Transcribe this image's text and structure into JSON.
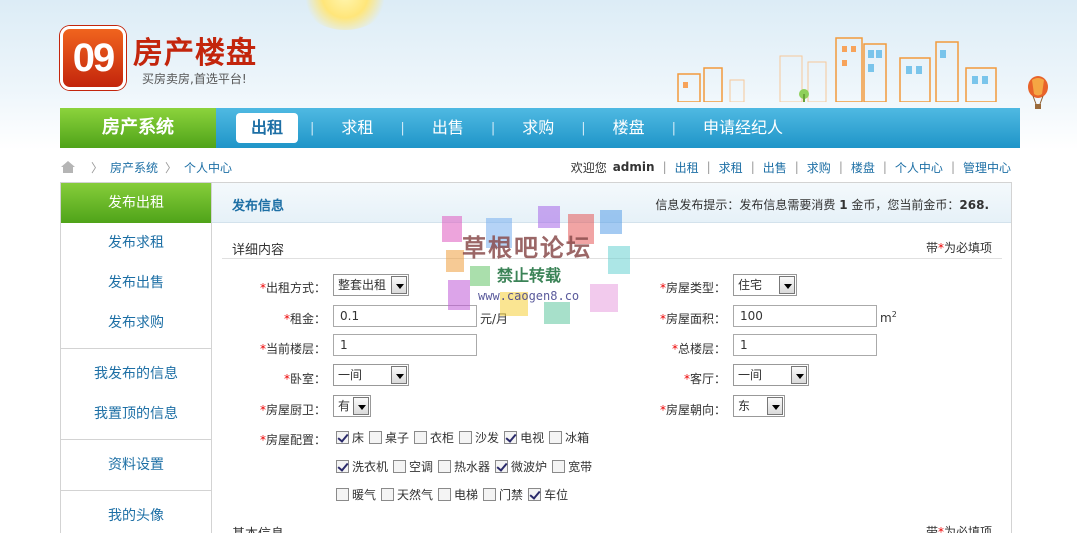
{
  "logo": {
    "mark": "09",
    "title": "房产楼盘",
    "slogan": "买房卖房,首选平台!"
  },
  "nav": {
    "brand": "房产系统",
    "items": [
      "出租",
      "求租",
      "出售",
      "求购",
      "楼盘",
      "申请经纪人"
    ],
    "active": "出租"
  },
  "breadcrumb": {
    "items": [
      "房产系统",
      "个人中心"
    ]
  },
  "userbar": {
    "welcome": "欢迎您",
    "username": "admin",
    "links": [
      "出租",
      "求租",
      "出售",
      "求购",
      "楼盘",
      "个人中心",
      "管理中心"
    ]
  },
  "sidebar": {
    "groups": [
      [
        "发布出租",
        "发布求租",
        "发布出售",
        "发布求购"
      ],
      [
        "我发布的信息",
        "我置顶的信息"
      ],
      [
        "资料设置"
      ],
      [
        "我的头像"
      ]
    ],
    "active": "发布出租"
  },
  "main": {
    "title": "发布信息",
    "hint_prefix": "信息发布提示：发布信息需要消费",
    "hint_cost": "1",
    "hint_middle": "金币，您当前金币：",
    "hint_balance": "268.",
    "section1": {
      "name": "详细内容",
      "req_prefix": "带",
      "req_star": "*",
      "req_suffix": "为必填项"
    },
    "section2": {
      "name": "基本信息",
      "req_prefix": "带",
      "req_star": "*",
      "req_suffix": "为必填项"
    }
  },
  "form": {
    "rent_type": {
      "label": "出租方式：",
      "value": "整套出租"
    },
    "house_type": {
      "label": "房屋类型：",
      "value": "住宅"
    },
    "rent": {
      "label": "租金：",
      "value": "0.1",
      "unit": "元/月"
    },
    "area": {
      "label": "房屋面积：",
      "value": "100",
      "unit": "m",
      "unit_sup": "2"
    },
    "floor": {
      "label": "当前楼层：",
      "value": "1"
    },
    "total_floors": {
      "label": "总楼层：",
      "value": "1"
    },
    "bedroom": {
      "label": "卧室：",
      "value": "一间"
    },
    "living": {
      "label": "客厅：",
      "value": "一间"
    },
    "kitchen_bath": {
      "label": "房屋厨卫：",
      "value": "有"
    },
    "orientation": {
      "label": "房屋朝向：",
      "value": "东"
    },
    "facilities": {
      "label": "房屋配置：",
      "rows": [
        [
          {
            "name": "床",
            "checked": true
          },
          {
            "name": "桌子",
            "checked": false
          },
          {
            "name": "衣柜",
            "checked": false
          },
          {
            "name": "沙发",
            "checked": false
          },
          {
            "name": "电视",
            "checked": true
          },
          {
            "name": "冰箱",
            "checked": false
          }
        ],
        [
          {
            "name": "洗衣机",
            "checked": true
          },
          {
            "name": "空调",
            "checked": false
          },
          {
            "name": "热水器",
            "checked": false
          },
          {
            "name": "微波炉",
            "checked": true
          },
          {
            "name": "宽带",
            "checked": false
          }
        ],
        [
          {
            "name": "暖气",
            "checked": false
          },
          {
            "name": "天然气",
            "checked": false
          },
          {
            "name": "电梯",
            "checked": false
          },
          {
            "name": "门禁",
            "checked": false
          },
          {
            "name": "车位",
            "checked": true
          }
        ]
      ]
    }
  },
  "watermark": {
    "title": "草根吧论坛",
    "subtitle": "禁止转载",
    "url": "www.caogen8.co"
  },
  "colors": {
    "nav_blue": "#1f95c8",
    "brand_green": "#4fa319",
    "link_blue": "#1d6fa5",
    "logo_red": "#c3250c",
    "required_red": "#ee0000"
  }
}
